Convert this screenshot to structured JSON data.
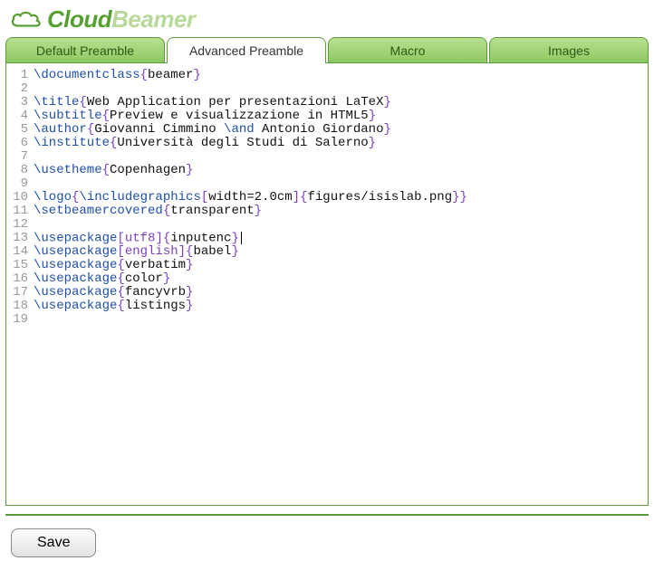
{
  "logo": {
    "word1": "Cloud",
    "word2": "Beamer"
  },
  "tabs": [
    {
      "label": "Default Preamble",
      "active": false
    },
    {
      "label": "Advanced Preamble",
      "active": true
    },
    {
      "label": "Macro",
      "active": false
    },
    {
      "label": "Images",
      "active": false
    }
  ],
  "buttons": {
    "save": "Save"
  },
  "code_lines": [
    [
      {
        "t": "cmd",
        "v": "\\documentclass"
      },
      {
        "t": "brace",
        "v": "{"
      },
      {
        "t": "text",
        "v": "beamer"
      },
      {
        "t": "brace",
        "v": "}"
      }
    ],
    [],
    [
      {
        "t": "cmd",
        "v": "\\title"
      },
      {
        "t": "brace",
        "v": "{"
      },
      {
        "t": "text",
        "v": "Web Application per presentazioni LaTeX"
      },
      {
        "t": "brace",
        "v": "}"
      }
    ],
    [
      {
        "t": "cmd",
        "v": "\\subtitle"
      },
      {
        "t": "brace",
        "v": "{"
      },
      {
        "t": "text",
        "v": "Preview e visualizzazione in HTML5"
      },
      {
        "t": "brace",
        "v": "}"
      }
    ],
    [
      {
        "t": "cmd",
        "v": "\\author"
      },
      {
        "t": "brace",
        "v": "{"
      },
      {
        "t": "text",
        "v": "Giovanni Cimmino "
      },
      {
        "t": "cmd",
        "v": "\\and"
      },
      {
        "t": "text",
        "v": " Antonio Giordano"
      },
      {
        "t": "brace",
        "v": "}"
      }
    ],
    [
      {
        "t": "cmd",
        "v": "\\institute"
      },
      {
        "t": "brace",
        "v": "{"
      },
      {
        "t": "text",
        "v": "Università degli Studi di Salerno"
      },
      {
        "t": "brace",
        "v": "}"
      }
    ],
    [],
    [
      {
        "t": "cmd",
        "v": "\\usetheme"
      },
      {
        "t": "brace",
        "v": "{"
      },
      {
        "t": "text",
        "v": "Copenhagen"
      },
      {
        "t": "brace",
        "v": "}"
      }
    ],
    [],
    [
      {
        "t": "cmd",
        "v": "\\logo"
      },
      {
        "t": "brace",
        "v": "{"
      },
      {
        "t": "cmd",
        "v": "\\includegraphics"
      },
      {
        "t": "bracket",
        "v": "["
      },
      {
        "t": "text",
        "v": "width=2.0cm"
      },
      {
        "t": "bracket",
        "v": "]"
      },
      {
        "t": "brace",
        "v": "{"
      },
      {
        "t": "text",
        "v": "figures/isislab.png"
      },
      {
        "t": "brace",
        "v": "}"
      },
      {
        "t": "brace",
        "v": "}"
      }
    ],
    [
      {
        "t": "cmd",
        "v": "\\setbeamercovered"
      },
      {
        "t": "brace",
        "v": "{"
      },
      {
        "t": "text",
        "v": "transparent"
      },
      {
        "t": "brace",
        "v": "}"
      }
    ],
    [],
    [
      {
        "t": "cmd",
        "v": "\\usepackage"
      },
      {
        "t": "bracket",
        "v": "["
      },
      {
        "t": "opt",
        "v": "utf8"
      },
      {
        "t": "bracket",
        "v": "]"
      },
      {
        "t": "brace",
        "v": "{"
      },
      {
        "t": "text",
        "v": "inputenc"
      },
      {
        "t": "brace",
        "v": "}"
      },
      {
        "t": "cursor",
        "v": ""
      }
    ],
    [
      {
        "t": "cmd",
        "v": "\\usepackage"
      },
      {
        "t": "bracket",
        "v": "["
      },
      {
        "t": "opt",
        "v": "english"
      },
      {
        "t": "bracket",
        "v": "]"
      },
      {
        "t": "brace",
        "v": "{"
      },
      {
        "t": "text",
        "v": "babel"
      },
      {
        "t": "brace",
        "v": "}"
      }
    ],
    [
      {
        "t": "cmd",
        "v": "\\usepackage"
      },
      {
        "t": "brace",
        "v": "{"
      },
      {
        "t": "text",
        "v": "verbatim"
      },
      {
        "t": "brace",
        "v": "}"
      }
    ],
    [
      {
        "t": "cmd",
        "v": "\\usepackage"
      },
      {
        "t": "brace",
        "v": "{"
      },
      {
        "t": "text",
        "v": "color"
      },
      {
        "t": "brace",
        "v": "}"
      }
    ],
    [
      {
        "t": "cmd",
        "v": "\\usepackage"
      },
      {
        "t": "brace",
        "v": "{"
      },
      {
        "t": "text",
        "v": "fancyvrb"
      },
      {
        "t": "brace",
        "v": "}"
      }
    ],
    [
      {
        "t": "cmd",
        "v": "\\usepackage"
      },
      {
        "t": "brace",
        "v": "{"
      },
      {
        "t": "text",
        "v": "listings"
      },
      {
        "t": "brace",
        "v": "}"
      }
    ],
    []
  ]
}
